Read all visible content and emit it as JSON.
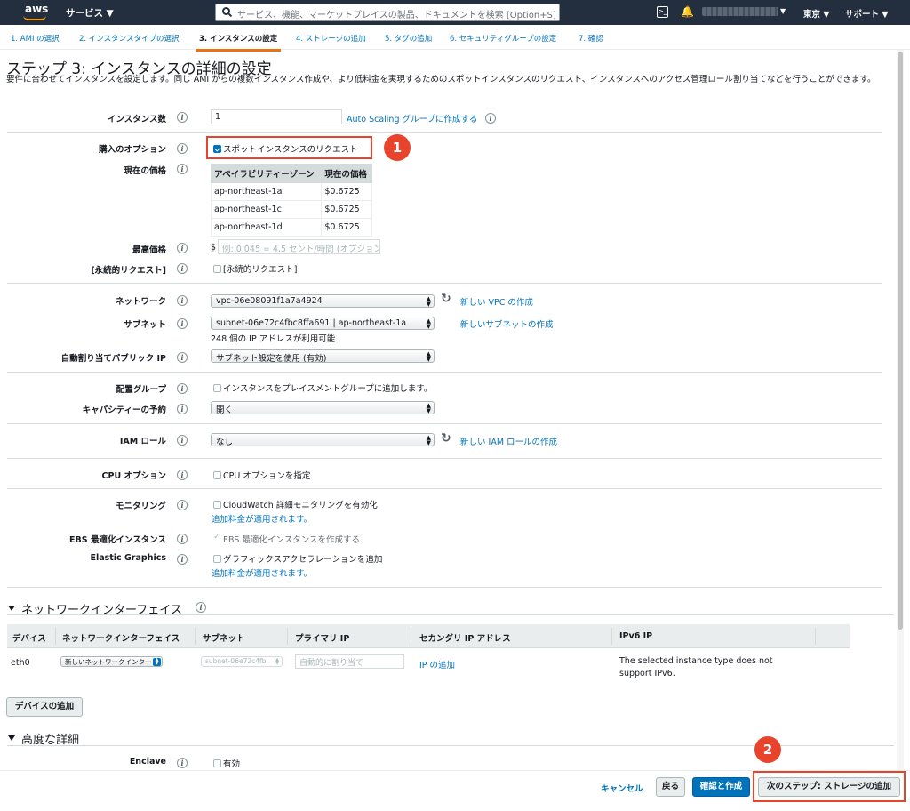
{
  "topnav": {
    "logo": "aws",
    "services": "サービス ▼",
    "search_placeholder": "サービス、機能、マーケットプレイスの製品、ドキュメントを検索 [Option+S]",
    "region": "東京 ▼",
    "support": "サポート ▼",
    "account_caret": "▼",
    "cloudshell_glyph": ">_",
    "bell_glyph": "🔔"
  },
  "tabs": [
    {
      "label": "1. AMI の選択"
    },
    {
      "label": "2. インスタンスタイプの選択"
    },
    {
      "label": "3. インスタンスの設定"
    },
    {
      "label": "4. ストレージの追加"
    },
    {
      "label": "5. タグの追加"
    },
    {
      "label": "6. セキュリティグループの設定"
    },
    {
      "label": "7. 確認"
    }
  ],
  "page": {
    "title": "ステップ 3: インスタンスの詳細の設定",
    "description": "要件に合わせてインスタンスを設定します。同じ AMI からの複数インスタンス作成や、より低料金を実現するためのスポットインスタンスのリクエスト、インスタンスへのアクセス管理ロール割り当てなどを行うことができます。"
  },
  "form": {
    "instance_count": {
      "label": "インスタンス数",
      "value": "1",
      "link": "Auto Scaling グループに作成する"
    },
    "purchase_option": {
      "label": "購入のオプション",
      "checkbox": "スポットインスタンスのリクエスト",
      "checked": true
    },
    "current_price": {
      "label": "現在の価格",
      "headers": [
        "アベイラビリティーゾーン",
        "現在の価格"
      ],
      "rows": [
        [
          "ap-northeast-1a",
          "$0.6725"
        ],
        [
          "ap-northeast-1c",
          "$0.6725"
        ],
        [
          "ap-northeast-1d",
          "$0.6725"
        ]
      ]
    },
    "max_price": {
      "label": "最高価格",
      "currency": "$",
      "placeholder": "例: 0.045 = 4.5 セント/時間 (オプション)"
    },
    "persistent_request": {
      "label": "[永続的リクエスト]",
      "checkbox": "[永続的リクエスト]"
    },
    "network": {
      "label": "ネットワーク",
      "value": "vpc-06e08091f1a7a4924",
      "link": "新しい VPC の作成"
    },
    "subnet": {
      "label": "サブネット",
      "value": "subnet-06e72c4fbc8ffa691 | ap-northeast-1a",
      "link": "新しいサブネットの作成",
      "note": "248 個の IP アドレスが利用可能"
    },
    "public_ip": {
      "label": "自動割り当てパブリック IP",
      "value": "サブネット設定を使用 (有効)"
    },
    "placement_group": {
      "label": "配置グループ",
      "checkbox": "インスタンスをプレイスメントグループに追加します。"
    },
    "capacity_reservation": {
      "label": "キャパシティーの予約",
      "value": "開く"
    },
    "iam_role": {
      "label": "IAM ロール",
      "value": "なし",
      "link": "新しい IAM ロールの作成"
    },
    "cpu_options": {
      "label": "CPU オプション",
      "checkbox": "CPU オプションを指定"
    },
    "monitoring": {
      "label": "モニタリング",
      "checkbox": "CloudWatch 詳細モニタリングを有効化",
      "note": "追加料金が適用されます。"
    },
    "ebs_optimized": {
      "label": "EBS 最適化インスタンス",
      "checkbox": "EBS 最適化インスタンスを作成する"
    },
    "elastic_graphics": {
      "label": "Elastic Graphics",
      "checkbox": "グラフィックスアクセラレーションを追加",
      "note": "追加料金が適用されます。"
    }
  },
  "network_interfaces": {
    "title": "ネットワークインターフェイス",
    "headers": [
      "デバイス",
      "ネットワークインターフェイス",
      "サブネット",
      "プライマリ IP",
      "セカンダリ IP アドレス",
      "IPv6 IP"
    ],
    "row": {
      "device": "eth0",
      "interface": "新しいネットワークインター",
      "subnet": "subnet-06e72c4fb",
      "primary_ip_placeholder": "自動的に割り当て",
      "secondary_link": "IP の追加",
      "ipv6_note": "The selected instance type does not support IPv6."
    },
    "add_device": "デバイスの追加"
  },
  "advanced": {
    "title": "高度な詳細",
    "enclave_label": "Enclave",
    "enclave_checkbox": "有効"
  },
  "footer": {
    "cancel": "キャンセル",
    "back": "戻る",
    "review_launch": "確認と作成",
    "next": "次のステップ: ストレージの追加"
  },
  "callouts": [
    "1",
    "2"
  ],
  "colors": {
    "nav_bg": "#232f3e",
    "accent_orange": "#ec7211",
    "link_blue": "#0073bb",
    "callout_red": "#e8442b",
    "primary_button": "#0073bb"
  },
  "icons": {
    "info": "i",
    "refresh": "↻",
    "select_arrows": "▲▼"
  }
}
